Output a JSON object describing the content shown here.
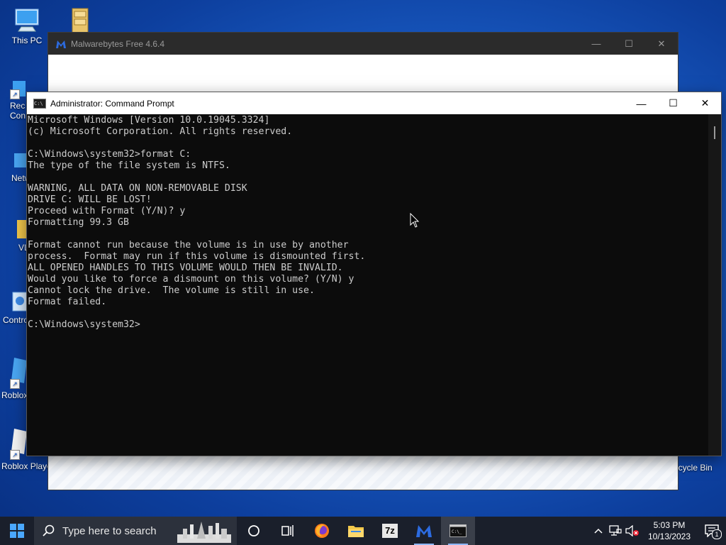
{
  "desktop": {
    "icons": [
      {
        "label": "This PC"
      },
      {
        "label": ""
      },
      {
        "label": "Rec Con"
      },
      {
        "label": "Netw"
      },
      {
        "label": "VL"
      },
      {
        "label": "Contro"
      },
      {
        "label": "Roblox"
      },
      {
        "label": "Roblox Playe"
      },
      {
        "label": "ecycle Bin"
      }
    ]
  },
  "malwarebytes": {
    "title": "Malwarebytes Free  4.6.4"
  },
  "cmd": {
    "title": "Administrator: Command Prompt",
    "lines": [
      "Microsoft Windows [Version 10.0.19045.3324]",
      "(c) Microsoft Corporation. All rights reserved.",
      "",
      "C:\\Windows\\system32>format C:",
      "The type of the file system is NTFS.",
      "",
      "WARNING, ALL DATA ON NON-REMOVABLE DISK",
      "DRIVE C: WILL BE LOST!",
      "Proceed with Format (Y/N)? y",
      "Formatting 99.3 GB",
      "",
      "Format cannot run because the volume is in use by another",
      "process.  Format may run if this volume is dismounted first.",
      "ALL OPENED HANDLES TO THIS VOLUME WOULD THEN BE INVALID.",
      "Would you like to force a dismount on this volume? (Y/N) y",
      "Cannot lock the drive.  The volume is still in use.",
      "Format failed.",
      "",
      "C:\\Windows\\system32>"
    ]
  },
  "taskbar": {
    "search_placeholder": "Type here to search",
    "apps": [
      "task-view",
      "firefox",
      "file-explorer",
      "7zip",
      "malwarebytes",
      "command-prompt"
    ],
    "seven_zip_label": "7z",
    "time": "5:03 PM",
    "date": "10/13/2023",
    "notification_count": "1"
  },
  "colors": {
    "desktop": "#1b5fc8",
    "cmd_background": "#0c0c0c",
    "cmd_text": "#cccccc",
    "taskbar": "#1a1f2b"
  }
}
